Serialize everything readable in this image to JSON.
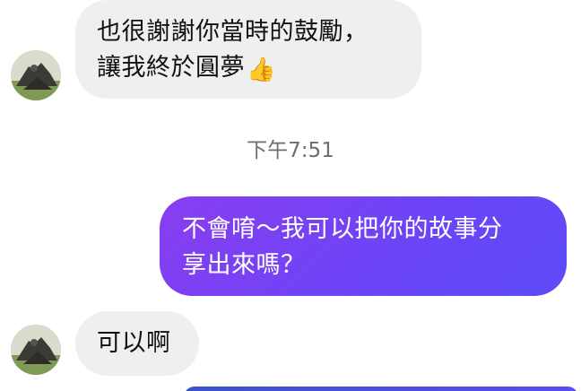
{
  "conversation": {
    "messages": [
      {
        "direction": "incoming",
        "lines": [
          "也很謝謝你當時的鼓勵，",
          "讓我終於圓夢"
        ],
        "emoji": "👍"
      },
      {
        "direction": "outgoing",
        "lines": [
          "不會唷～我可以把你的故事分",
          "享出來嗎？"
        ]
      },
      {
        "direction": "incoming",
        "lines": [
          "可以啊"
        ]
      }
    ],
    "timestamp": "下午7:51"
  },
  "icons": {
    "avatar": "contact-avatar-photo",
    "thumbs_up": "thumbs-up-emoji"
  },
  "colors": {
    "incoming_bubble": "#efefef",
    "outgoing_bubble_start": "#8a3df0",
    "outgoing_bubble_end": "#5e4bf8",
    "timestamp_text": "#6e6e6e"
  }
}
